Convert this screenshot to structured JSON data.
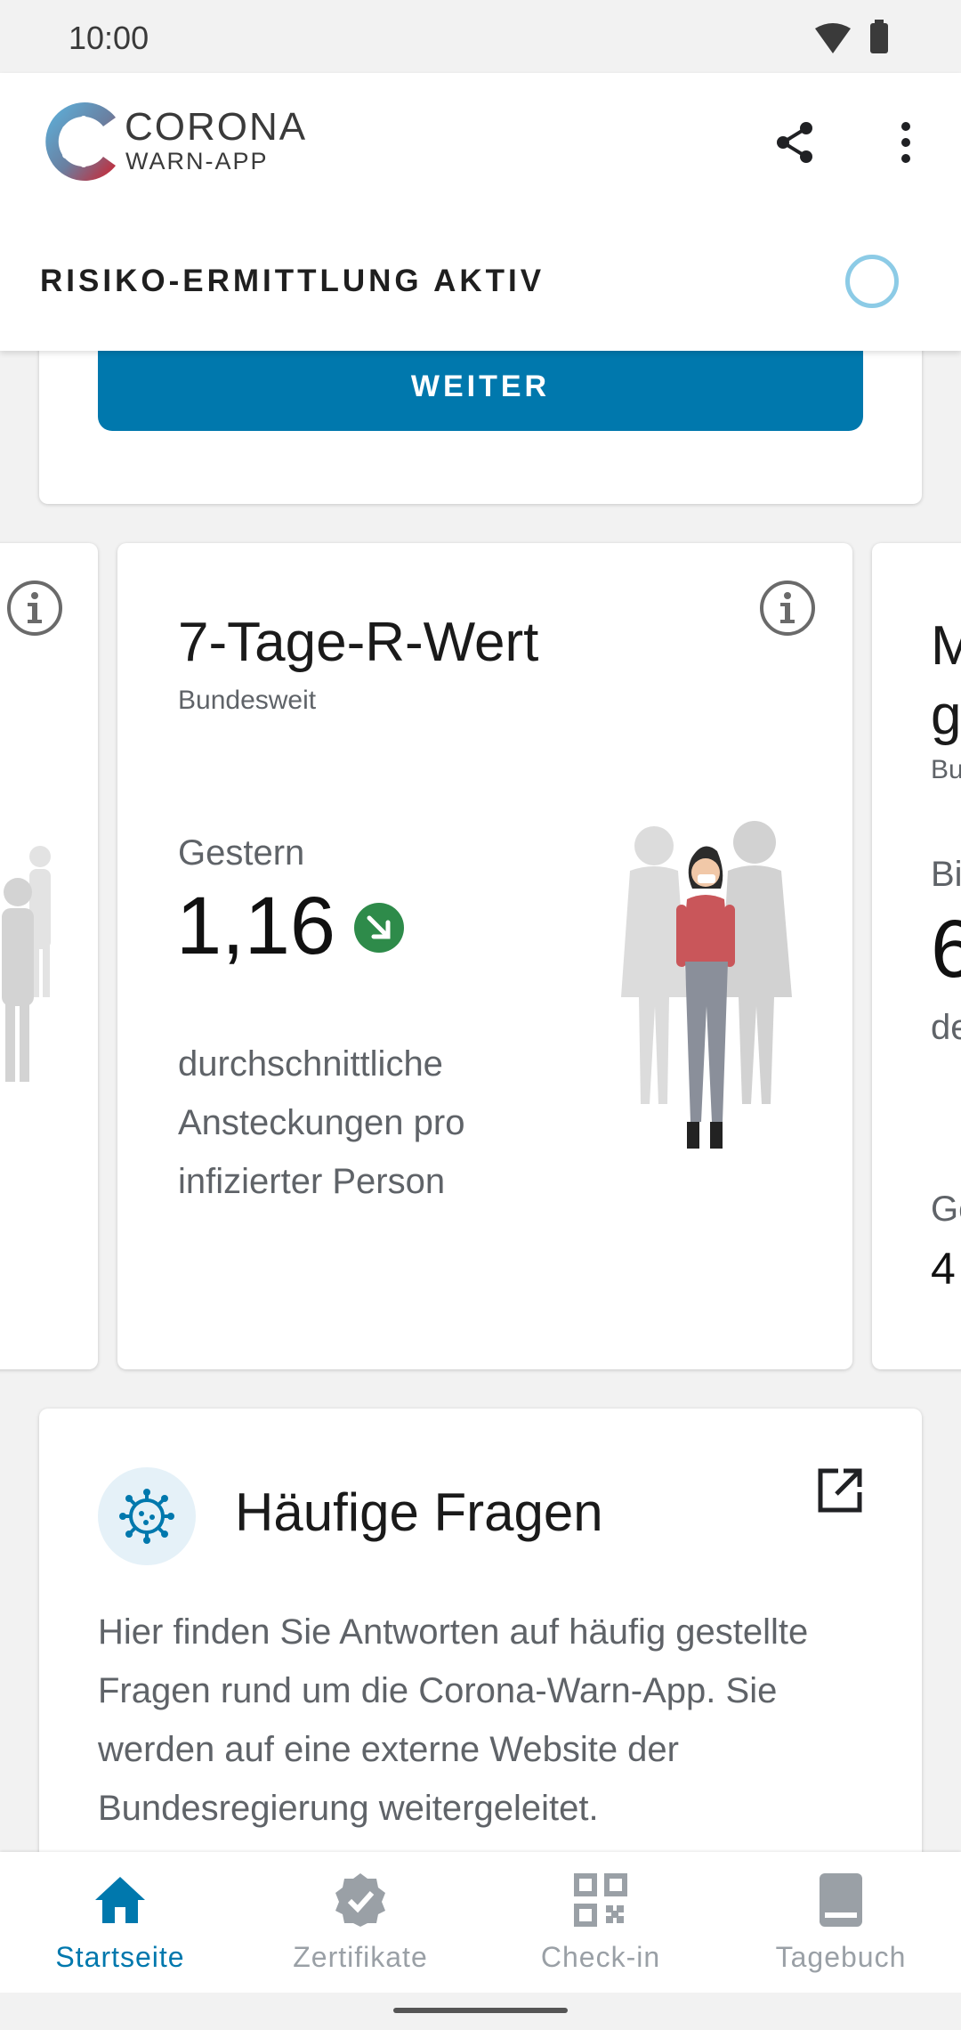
{
  "status_bar": {
    "time": "10:00"
  },
  "app": {
    "logo_title": "CORONA",
    "logo_subtitle": "WARN-APP"
  },
  "risk": {
    "label": "RISIKO-ERMITTLUNG AKTIV"
  },
  "continue_card": {
    "button_label": "WEITER"
  },
  "stats_card": {
    "title": "7-Tage-R-Wert",
    "subtitle": "Bundesweit",
    "label": "Gestern",
    "value": "1,16",
    "trend": "decreasing",
    "description": "durchschnittliche Ansteckungen pro infizierter Person"
  },
  "next_card_partial": {
    "title_line1": "M",
    "title_line2": "g",
    "subtitle": "Bu",
    "label": "Bi",
    "value": "6",
    "description": "de",
    "label2": "Ge",
    "value2": "4"
  },
  "faq_card": {
    "title": "Häufige Fragen",
    "body": "Hier finden Sie Antworten auf häufig gestellte Fragen rund um die Corona-Warn-App. Sie werden auf eine externe Website der Bundesregierung weitergeleitet."
  },
  "bottom_nav": {
    "items": [
      {
        "label": "Startseite",
        "icon": "home-icon",
        "active": true
      },
      {
        "label": "Zertifikate",
        "icon": "certificate-icon",
        "active": false
      },
      {
        "label": "Check-in",
        "icon": "qr-code-icon",
        "active": false
      },
      {
        "label": "Tagebuch",
        "icon": "diary-icon",
        "active": false
      }
    ]
  },
  "colors": {
    "primary": "#0078ad",
    "trend_green": "#2e8b4a",
    "risk_circle": "#8ccbe6"
  }
}
